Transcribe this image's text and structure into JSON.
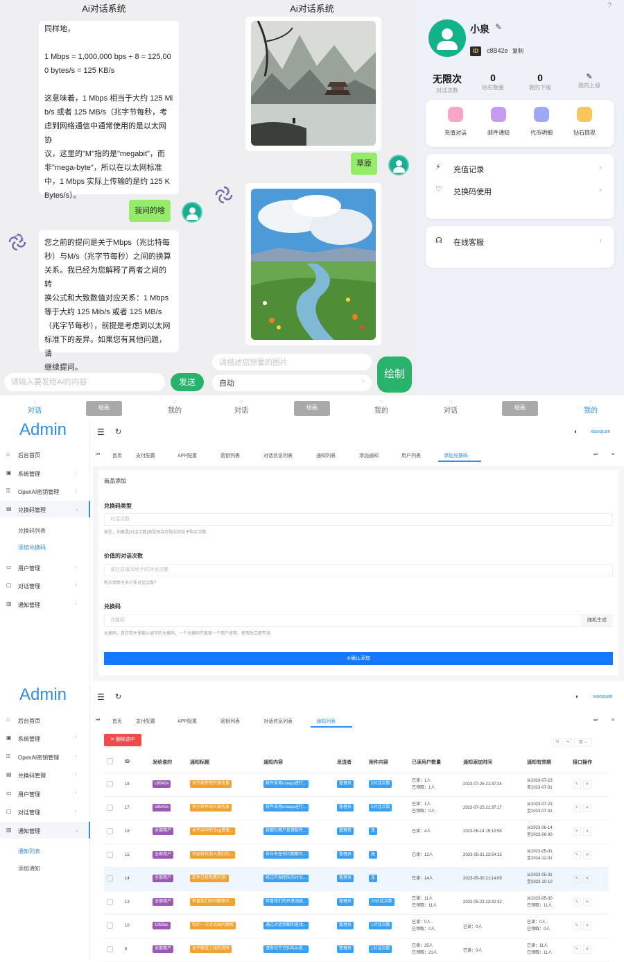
{
  "chat_left": {
    "title": "Ai对话系统",
    "bubble1": "同样地，\n\n1 Mbps = 1,000,000 bps ÷ 8 = 125,00\n0 bytes/s = 125 KB/s\n\n这意味着，1 Mbps 相当于大约 125 Mi\nb/s 或者 125 MB/s（兆字节每秒，考\n虑到网络通信中通常使用的是以太网协\n议，这里的\"M\"指的是\"megabit\"，而\n非\"mega-byte\"，所以在以太网标准\n中，1 Mbps 实际上传输的是约 125 K\nBytes/s）。",
    "user_msg": "我问的啥",
    "bubble2": "您之前的提问是关于Mbps（兆比特每\n秒）与M/s（兆字节每秒）之间的换算\n关系。我已经为您解释了两者之间的转\n换公式和大致数值对应关系：1 Mbps\n等于大约 125 Mib/s 或者 125 MB/s\n（兆字节每秒），前提是考虑到以太网\n标准下的差异。如果您有其他问题，请\n继续提问。",
    "input_placeholder": "请输入要发给AI的内容",
    "send": "发送"
  },
  "chat_mid": {
    "title": "Ai对话系统",
    "plus": "+",
    "user_msg": "草原",
    "prompt_placeholder": "请描述您想要的图片",
    "mode": "自动",
    "draw": "绘制"
  },
  "profile": {
    "help": "?",
    "name": "小泉",
    "id_badge": "ID",
    "id_value": "c8B42e",
    "copy": "复制",
    "stats": [
      {
        "value": "无限次",
        "label": "对话次数"
      },
      {
        "value": "0",
        "label": "钻石数量"
      },
      {
        "value": "0",
        "label": "我的下级"
      },
      {
        "value": "",
        "label": "我的上级"
      }
    ],
    "quick": [
      "充值对话",
      "邮件通知",
      "代币明细",
      "钻石提现"
    ],
    "rows1": [
      "充值记录",
      "兑换码使用"
    ],
    "rows2": [
      "在线客服"
    ]
  },
  "tabbar": {
    "items": [
      "对话",
      "绘画",
      "我的",
      "对话",
      "绘画",
      "我的",
      "对话",
      "绘画",
      "我的"
    ]
  },
  "admin": {
    "brand": "Admin",
    "user": "xiaoquan",
    "menu1": [
      "后台首页",
      "系统管理",
      "OpenAI密钥管理",
      "兑换码管理",
      "用户管理",
      "对话管理",
      "通知管理"
    ],
    "sub1": [
      "兑换码列表",
      "添加兑换码"
    ],
    "tabs1": [
      "首页",
      "支付配置",
      "APP配置",
      "密钥列表",
      "对话信息列表",
      "通知列表",
      "添加通知",
      "用户列表",
      "添加兑换码"
    ],
    "form_title": "商品添加",
    "f1_label": "兑换码类型",
    "f1_value": "对话次数",
    "f1_hint": "类型，如果是[对话次数]类型则会在购买后给予购买次数",
    "f2_label": "价值的对话次数",
    "f2_placeholder": "请在这填写给予的对话次数",
    "f2_hint": "购买后给予多少条对话次数?",
    "f3_label": "兑换码",
    "f3_placeholder": "兑换码",
    "f3_random": "随机生成",
    "f3_hint": "兑换码，是在软件里输入填写的兑换码，一个兑换码只能被一个用户使用，使用后立即失效",
    "submit": "⊘确认添加",
    "menu2": [
      "后台首页",
      "系统管理",
      "OpenAI密钥管理",
      "兑换码管理",
      "用户管理",
      "对话管理",
      "通知管理"
    ],
    "sub2": [
      "通知列表",
      "添加通知"
    ],
    "tabs2": [
      "首页",
      "支付配置",
      "APP配置",
      "密钥列表",
      "对话信息列表",
      "通知列表"
    ],
    "delete_btn": "✕ 删除选中",
    "columns": [
      "ID",
      "发给谁的",
      "通知标题",
      "通知内容",
      "发送者",
      "附件内容",
      "已读用户数量",
      "通知添加时间",
      "通知有效期",
      "接口操作"
    ],
    "rows": [
      {
        "id": "18",
        "to": "c8B42e",
        "title": "关于软件的开源信息",
        "content": "软件采用uniapp进行...",
        "sender": "管理员",
        "attach": "5对话次数",
        "read": "已读：1人\n已领取：1人",
        "time": "2023-07-25 21:37:34",
        "valid": "从2023-07-23\n至2023-07-31"
      },
      {
        "id": "17",
        "to": "c8B42e",
        "title": "关于软件的开源信息",
        "content": "软件采用uniapp进行...",
        "sender": "管理员",
        "attach": "5对话次数",
        "read": "已读：1人\n已领取：0人",
        "time": "2023-07-25 21:37:17",
        "valid": "从2023-07-23\n至2023-07-31"
      },
      {
        "id": "16",
        "to": "全部用户",
        "title": "关于APP的 Bug修复...",
        "content": "经部分用户反馈软件...",
        "sender": "管理员",
        "attach": "无",
        "read": "已读：4人",
        "time": "2023-06-14 15:10:58",
        "valid": "从2023-06-14\n至2023-06-30"
      },
      {
        "id": "15",
        "to": "全部用户",
        "title": "欢迎各位加入我们的...",
        "content": "各位有任何问题都可...",
        "sender": "管理员",
        "attach": "无",
        "read": "已读：12人",
        "time": "2023-05-31 23:54:15",
        "valid": "从2023-05-31\n至2024-12-31"
      },
      {
        "id": "14",
        "to": "全部用户",
        "title": "软件已经免费开放!",
        "content": "经过开发团队的讨论...",
        "sender": "管理员",
        "attach": "无",
        "read": "已读：14人",
        "time": "2023-05-30 21:14:09",
        "valid": "从2023-05-31\n至2023-10-10"
      },
      {
        "id": "13",
        "to": "全部用户",
        "title": "恭喜我们的问题修正...",
        "content": "恭喜我们的开发团成...",
        "sender": "管理员",
        "attach": "20对话次数",
        "read": "已读：11人\n已领取：11人",
        "time": "2023-05-23 23:42:32",
        "valid": "从2023-05-30\n已领取：11人"
      },
      {
        "id": "10",
        "to": "1059ac",
        "title": "你的一次对话出问题啦",
        "content": "通过对话到期的查找...",
        "sender": "管理员",
        "attach": "1对话次数",
        "read": "已读：0人\n已领取：0人",
        "time": "已读：0人",
        "valid": "已读：0人\n已领取：0人"
      },
      {
        "id": "8",
        "to": "全部用户",
        "title": "关于新版上线的说明",
        "content": "请各位千万别与AI说...",
        "sender": "管理员",
        "attach": "1对话次数",
        "read": "已读：25人\n已领取：21人",
        "time": "已读：0人",
        "valid": "已读：11人\n已领取：11人"
      }
    ]
  }
}
